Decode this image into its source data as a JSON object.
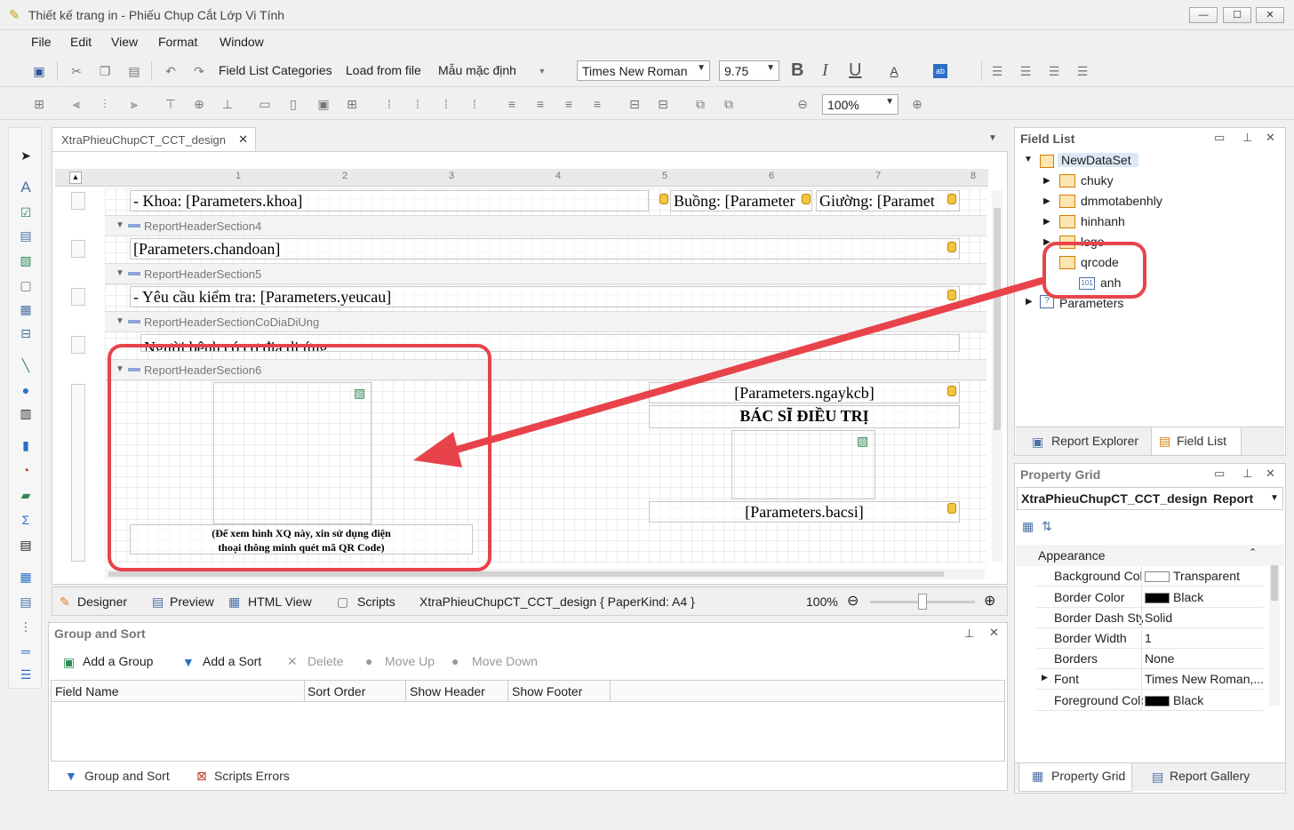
{
  "window": {
    "title": "Thiết kế trang in - Phiếu Chụp Cắt Lớp Vi Tính",
    "minimize": "—",
    "maximize": "☐",
    "close": "✕"
  },
  "menu": [
    "File",
    "Edit",
    "View",
    "Format",
    "Window"
  ],
  "toolbar": {
    "field_list_categories": "Field List Categories",
    "load_from_file": "Load from file",
    "default_template": "Mẫu mặc định",
    "font_name": "Times New Roman",
    "font_size": "9.75",
    "bold": "B",
    "italic": "I",
    "underline": "U",
    "zoom": "100%"
  },
  "doc_tab": {
    "label": "XtraPhieuChupCT_CCT_design",
    "close": "✕"
  },
  "report": {
    "khoa": "- Khoa: [Parameters.khoa]",
    "buong": "Buồng: [Parameter",
    "giuong": "Giường: [Paramet",
    "band4": "ReportHeaderSection4",
    "chandoan": "[Parameters.chandoan]",
    "band5": "ReportHeaderSection5",
    "yeucau": "- Yêu cầu kiểm tra: [Parameters.yeucau]",
    "band_cdu": "ReportHeaderSectionCoDiaDiUng",
    "diung": "Người bệnh có cơ địa dị ứng:",
    "band6": "ReportHeaderSection6",
    "qr_note_1": "(Để xem hình XQ này, xin sử dụng điện",
    "qr_note_2": "thoại thông minh quét mã QR Code)",
    "ngaykcb": "[Parameters.ngaykcb]",
    "bacsi_title": "BÁC SĨ ĐIỀU TRỊ",
    "bacsi": "[Parameters.bacsi]"
  },
  "ruler_ticks": [
    "1",
    "2",
    "3",
    "4",
    "5",
    "6",
    "7",
    "8"
  ],
  "status": {
    "designer": "Designer",
    "preview": "Preview",
    "html_view": "HTML View",
    "scripts": "Scripts",
    "info": "XtraPhieuChupCT_CCT_design { PaperKind: A4 }",
    "zoom": "100%"
  },
  "group_sort": {
    "title": "Group and Sort",
    "add_group": "Add a Group",
    "add_sort": "Add a Sort",
    "delete": "Delete",
    "move_up": "Move Up",
    "move_down": "Move Down",
    "columns": [
      "Field Name",
      "Sort Order",
      "Show Header",
      "Show Footer"
    ],
    "tab_group_sort": "Group and Sort",
    "tab_scripts_errors": "Scripts Errors"
  },
  "field_list": {
    "title": "Field List",
    "root": "NewDataSet",
    "items": [
      "chuky",
      "dmmotabenhly",
      "hinhanh",
      "logo",
      "qrcode"
    ],
    "qrcode_child": "anh",
    "parameters": "Parameters",
    "tab_report_explorer": "Report Explorer",
    "tab_field_list": "Field List"
  },
  "property_grid": {
    "title": "Property Grid",
    "object": "XtraPhieuChupCT_CCT_design",
    "object_type": "Report",
    "category": "Appearance",
    "rows": [
      {
        "k": "Background Colo",
        "v": "Transparent",
        "swatch": "#ffffff"
      },
      {
        "k": "Border Color",
        "v": "Black",
        "swatch": "#000000"
      },
      {
        "k": "Border Dash Sty",
        "v": "Solid",
        "swatch": ""
      },
      {
        "k": "Border Width",
        "v": "1",
        "swatch": ""
      },
      {
        "k": "Borders",
        "v": "None",
        "swatch": ""
      },
      {
        "k": "Font",
        "v": "Times New Roman,...",
        "swatch": ""
      },
      {
        "k": "Foreground Colo",
        "v": "Black",
        "swatch": "#000000"
      }
    ],
    "tab_property_grid": "Property Grid",
    "tab_report_gallery": "Report Gallery"
  },
  "colors": {
    "annotation": "#e8434b",
    "accent": "#2b579a"
  }
}
